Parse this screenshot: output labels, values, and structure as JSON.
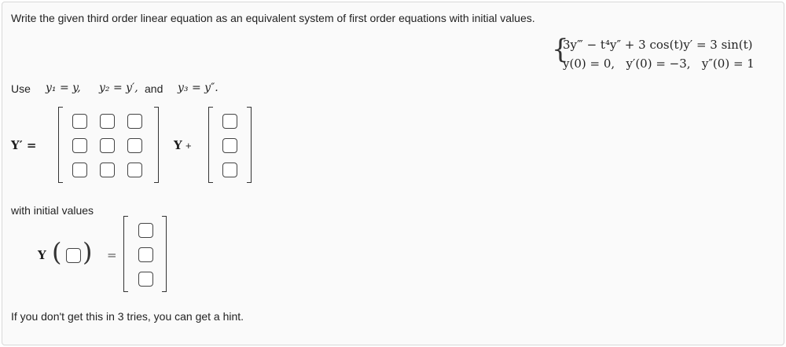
{
  "question": {
    "prompt": "Write the given third order linear equation as an equivalent system of first order equations with initial values.",
    "system": {
      "brace": "{",
      "equation": "3y‴ − t⁴y″ + 3 cos(t)y′ = 3 sin(t)",
      "initial": "y(0) = 0,   y′(0) = −3,   y″(0) = 1"
    },
    "use_line": {
      "use": "Use",
      "y1": "y₁ = y,",
      "y2": "y₂ = y′,",
      "and": "and",
      "y3": "y₃ = y″."
    },
    "matrix_eq": {
      "lhs": "Y′ =",
      "Y": "Y",
      "plus": "+"
    },
    "initial_values_label": "with initial values",
    "initial_eq": {
      "Y": "Y",
      "lparen": "(",
      "rparen": ")",
      "equals": "="
    },
    "hint": "If you don't get this in 3 tries, you can get a hint."
  }
}
